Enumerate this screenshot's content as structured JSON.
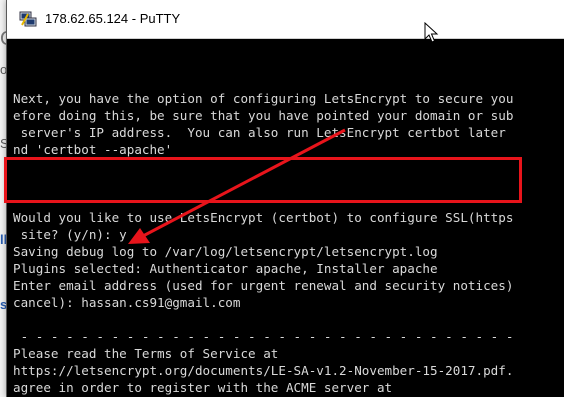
{
  "window": {
    "title": "178.62.65.124 - PuTTY",
    "icon": "putty-icon"
  },
  "background": {
    "fragments": [
      "O",
      "o",
      "Se",
      "ll",
      "s."
    ]
  },
  "terminal": {
    "lines": [
      "Next, you have the option of configuring LetsEncrypt to secure you",
      "efore doing this, be sure that you have pointed your domain or sub",
      " server's IP address.  You can also run LetsEncrypt certbot later",
      "nd 'certbot --apache'",
      "",
      "",
      "",
      "Would you like to use LetsEncrypt (certbot) to configure SSL(https",
      " site? (y/n): y",
      "Saving debug log to /var/log/letsencrypt/letsencrypt.log",
      "Plugins selected: Authenticator apache, Installer apache",
      "Enter email address (used for urgent renewal and security notices)",
      "cancel): hassan.cs91@gmail.com",
      "",
      " - - - - - - - - - - - - - - - - - - - - - - - - - - - - - - - - -",
      "Please read the Terms of Service at",
      "https://letsencrypt.org/documents/LE-SA-v1.2-November-15-2017.pdf.",
      "agree in order to register with the ACME server at",
      "https://acme-v02.api.letsencrypt.org/directory"
    ]
  },
  "annotations": {
    "highlight_color": "#e8141b",
    "arrow_color": "#e8141b"
  },
  "colors": {
    "terminal_bg": "#000000",
    "terminal_fg": "#d9d9d9"
  }
}
